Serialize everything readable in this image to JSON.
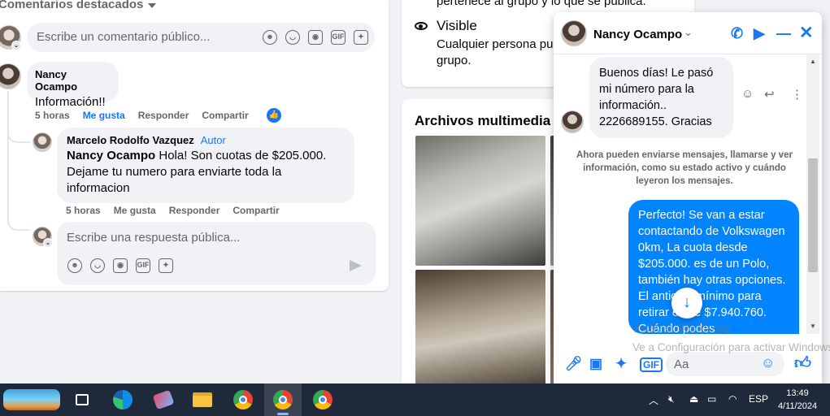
{
  "post": {
    "sort_label": "Comentarios destacados",
    "comment_placeholder": "Escribe un comentario público...",
    "composer_icons": [
      "emoji-icon",
      "smiley-icon",
      "camera-icon",
      "gif-icon",
      "sticker-icon"
    ],
    "gif_label": "GIF",
    "comments": [
      {
        "name": "Nancy Ocampo",
        "text": "Información!!",
        "time": "5 horas",
        "like": "Me gusta",
        "reply": "Responder",
        "share": "Compartir"
      },
      {
        "name": "Marcelo Rodolfo Vazquez",
        "badge": "Autor",
        "mention": "Nancy Ocampo",
        "text": " Hola! Son cuotas de $205.000. Dejame tu numero para enviarte toda la informacion",
        "time": "5 horas",
        "like": "Me gusta",
        "reply": "Responder",
        "share": "Compartir"
      }
    ],
    "reply_placeholder": "Escribe una respuesta pública..."
  },
  "group_info": {
    "truncated_text": "pertenece al grupo y lo que se publica.",
    "visible_title": "Visible",
    "visible_desc": "Cualquier persona pue grupo."
  },
  "media": {
    "title": "Archivos multimedia re"
  },
  "messenger": {
    "contact_name": "Nancy Ocampo",
    "incoming_message": "Buenos días! Le pasó mi número para la información.. 2226689155. Gracias",
    "info_text": "Ahora pueden enviarse mensajes, llamarse y ver información, como su estado activo y cuándo leyeron los mensajes.",
    "outgoing_message": "Perfecto!  Se van a estar contactando de Volkswagen 0km, La cuota desde $205.000. es de un Polo, también hay otras opciones. El anticipo mínimo para retirar es de $7.940.760. Cuándo podes",
    "input_placeholder": "Aa",
    "gif_label": "GIF",
    "accent_color": "#0084ff"
  },
  "watermark": {
    "line1": "Activar Windows",
    "line2": "Ve a Configuración para activar Windows."
  },
  "taskbar": {
    "language": "ESP",
    "time": "13:49",
    "date": "4/11/2024"
  }
}
